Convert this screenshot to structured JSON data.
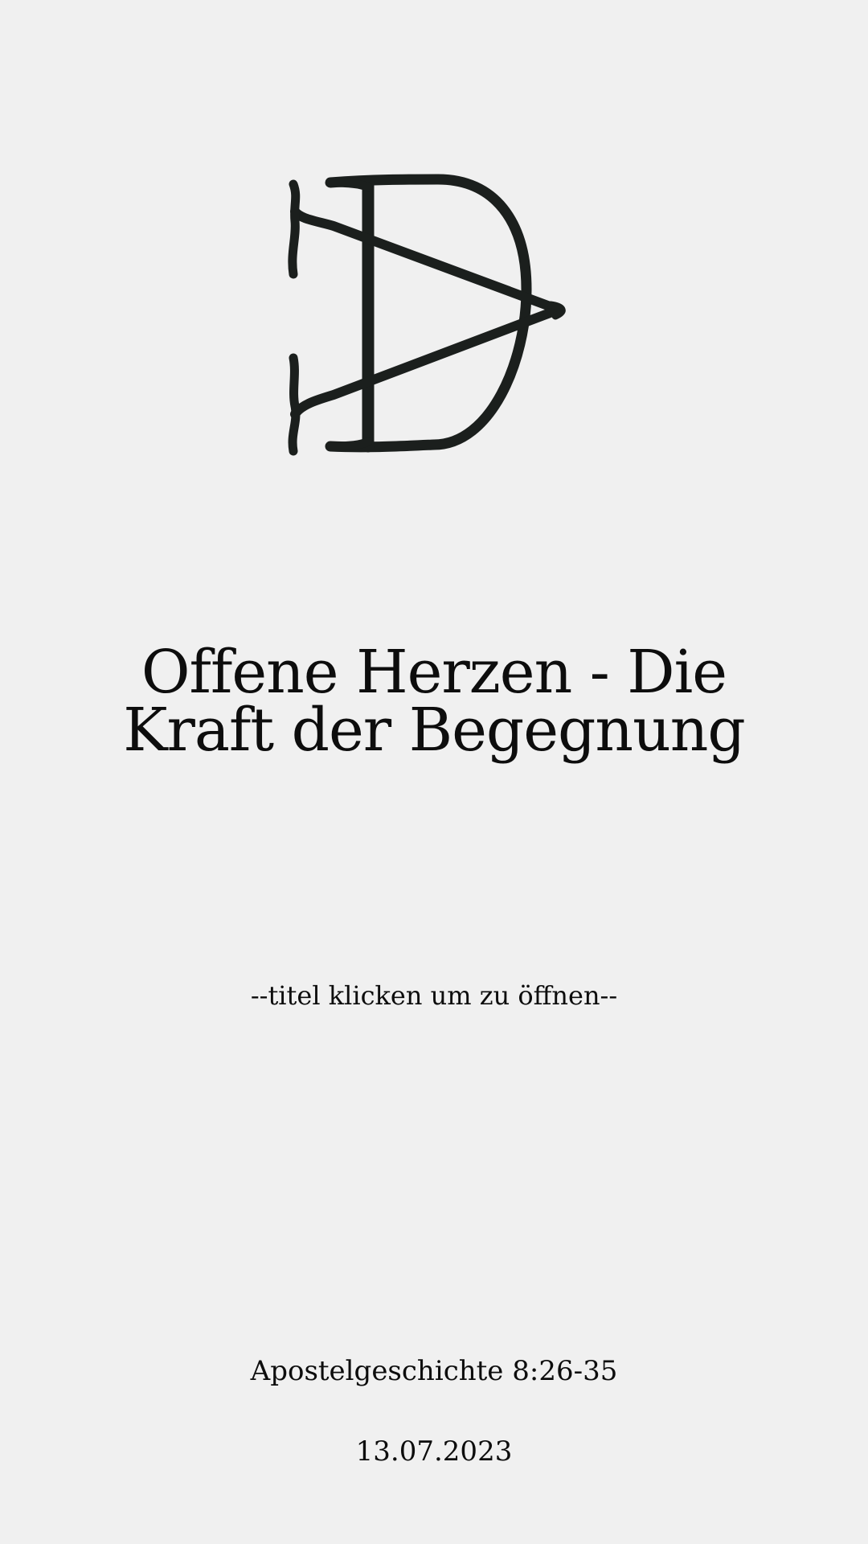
{
  "logo": {
    "icon": "dv-monogram-icon",
    "color": "#1b1f1d"
  },
  "title": {
    "line1": "Offene Herzen - Die",
    "line2": "Kraft der Begegnung"
  },
  "hint": "--titel klicken um zu öffnen--",
  "scripture": "Apostelgeschichte 8:26-35",
  "date": "13.07.2023",
  "colors": {
    "background": "#f0f0f0",
    "text": "#0d0d0d"
  }
}
